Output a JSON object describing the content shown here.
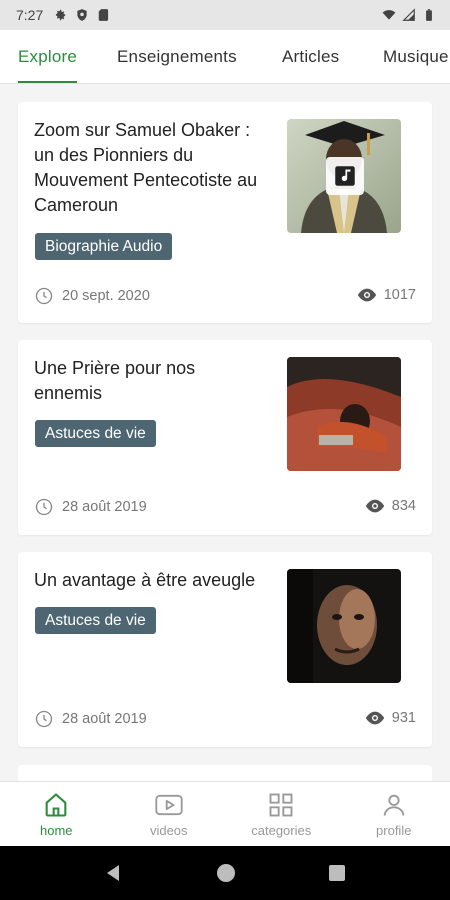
{
  "status_bar": {
    "time": "7:27"
  },
  "tabs": [
    {
      "label": "Explore",
      "active": true
    },
    {
      "label": "Enseignements",
      "active": false
    },
    {
      "label": "Articles",
      "active": false
    },
    {
      "label": "Musique",
      "active": false
    }
  ],
  "cards": [
    {
      "title": "Zoom sur Samuel Obaker : un des Pionniers du Mouvement Pentecotiste au Cameroun",
      "badge": "Biographie Audio",
      "date": "20 sept. 2020",
      "views": "1017",
      "thumb_icon": "music-note-icon"
    },
    {
      "title": "Une Prière pour nos ennemis",
      "badge": "Astuces de vie",
      "date": "28 août 2019",
      "views": "834"
    },
    {
      "title": "Un avantage à être aveugle",
      "badge": "Astuces de vie",
      "date": "28 août 2019",
      "views": "931"
    }
  ],
  "bottom_nav": [
    {
      "label": "home",
      "icon": "home-icon",
      "active": true
    },
    {
      "label": "videos",
      "icon": "play-icon",
      "active": false
    },
    {
      "label": "categories",
      "icon": "grid-icon",
      "active": false
    },
    {
      "label": "profile",
      "icon": "person-icon",
      "active": false
    }
  ],
  "colors": {
    "accent": "#2e8b3e",
    "badge": "#4e6672"
  }
}
